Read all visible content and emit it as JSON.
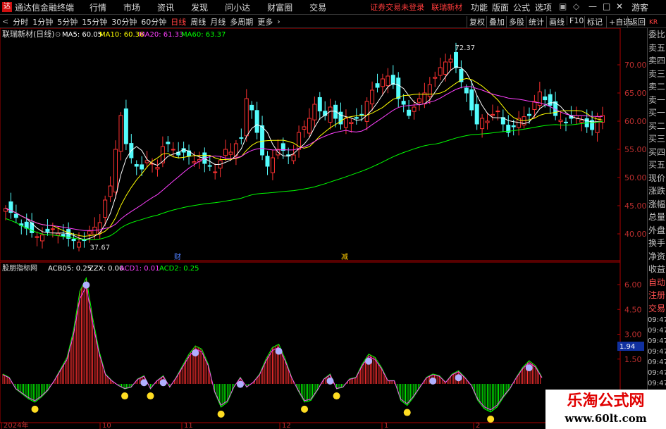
{
  "app": {
    "name": "通达信金融终端",
    "menus": [
      "行情",
      "市场",
      "资讯",
      "发现",
      "问小达",
      "财富圈",
      "交易"
    ],
    "notice": "证券交易未登录",
    "stock_title": "联瑞新材",
    "right_menus": [
      "功能",
      "版面",
      "公式",
      "选项"
    ],
    "guest": "游客"
  },
  "toolbar": {
    "periods": [
      "分时",
      "1分钟",
      "5分钟",
      "15分钟",
      "30分钟",
      "60分钟",
      "日线",
      "周线",
      "月线",
      "多周期",
      "更多"
    ],
    "active": "日线",
    "right_buttons": [
      "复权",
      "叠加",
      "多股",
      "统计",
      "画线",
      "F10",
      "标记",
      "+自选",
      "返回"
    ]
  },
  "main": {
    "name": "联瑞新材(日线)",
    "ma": [
      {
        "label": "MA5: 60.05",
        "color": "#ffffff"
      },
      {
        "label": "MA10: 60.36",
        "color": "#ffff00"
      },
      {
        "label": "MA20: 61.33",
        "color": "#ff40ff"
      },
      {
        "label": "MA60: 63.37",
        "color": "#00ff00"
      }
    ],
    "y_ticks": [
      "70.00",
      "65.00",
      "60.00",
      "55.00",
      "50.00",
      "45.00",
      "40.00"
    ],
    "hi_label": "72.37",
    "lo_label": "37.67",
    "mark1": "财",
    "mark2": "减"
  },
  "indicator": {
    "name": "股朋指标网",
    "fields": [
      {
        "label": "ACB05: 0.25",
        "color": "#ffffff"
      },
      {
        "label": "ZZX: 0.00",
        "color": "#ffffff"
      },
      {
        "label": "ACD1: 0.01",
        "color": "#ff40ff"
      },
      {
        "label": "ACD2: 0.25",
        "color": "#00ff00"
      }
    ],
    "y_ticks": [
      "6.00",
      "4.50",
      "3.00",
      "1.50"
    ],
    "current": "1.94"
  },
  "x_labels": [
    "2024年",
    "10",
    "11",
    "12",
    "1",
    "2"
  ],
  "side": {
    "top": [
      "委比",
      "卖五",
      "卖四",
      "卖三",
      "卖二",
      "卖一",
      "买一",
      "买二",
      "买三",
      "买四",
      "买五",
      "现价",
      "涨跌",
      "涨幅",
      "总量",
      "外盘",
      "换手",
      "净资",
      "收益"
    ],
    "bottom": [
      "自动",
      "注册",
      "交易"
    ],
    "times": [
      "09:47",
      "09:47",
      "09:47",
      "09:47",
      "09:47",
      "09:47",
      "09:47",
      "09:47"
    ],
    "corner": "KR"
  },
  "watermark": {
    "line1": "乐淘公式网",
    "line2": "www.60lt.com"
  },
  "chart_data": {
    "type": "candlestick",
    "closes": [
      44.5,
      43.8,
      42.9,
      41.5,
      41.0,
      40.2,
      39.5,
      39.8,
      40.4,
      40.9,
      40.1,
      39.6,
      39.2,
      38.8,
      38.5,
      38.9,
      40.5,
      41.2,
      42.0,
      46.0,
      48.5,
      55.0,
      61.0,
      56.0,
      53.5,
      52.0,
      51.5,
      53.0,
      52.5,
      51.8,
      55.5,
      56.0,
      55.0,
      54.0,
      54.5,
      53.8,
      52.8,
      53.2,
      52.5,
      52.0,
      51.0,
      53.0,
      55.0,
      54.5,
      56.0,
      57.0,
      64.0,
      62.0,
      58.0,
      54.0,
      52.0,
      53.5,
      55.0,
      54.8,
      53.8,
      54.0,
      58.0,
      59.0,
      60.5,
      63.0,
      61.8,
      61.0,
      62.5,
      60.5,
      59.5,
      60.5,
      59.8,
      60.5,
      61.0,
      63.5,
      65.5,
      66.0,
      67.5,
      68.0,
      66.5,
      64.0,
      63.0,
      61.0,
      62.5,
      64.0,
      65.0,
      66.5,
      67.8,
      69.5,
      70.5,
      71.0,
      69.5,
      67.0,
      65.0,
      62.0,
      59.5,
      60.5,
      60.0,
      61.2,
      61.8,
      59.5,
      58.0,
      59.0,
      60.5,
      60.8,
      61.0,
      63.5,
      65.2,
      63.8,
      62.8,
      61.0,
      60.2,
      59.8,
      60.5,
      61.0,
      60.2,
      59.0,
      58.5,
      60.8,
      61.0
    ],
    "hi_low": [
      72.37,
      37.67
    ],
    "ind": [
      0.6,
      0.4,
      -0.3,
      -0.6,
      -0.9,
      -1.1,
      -0.8,
      -0.4,
      0.2,
      0.9,
      1.6,
      3.2,
      5.6,
      6.4,
      4.0,
      2.0,
      0.6,
      0.2,
      -0.1,
      -0.3,
      -0.2,
      0.3,
      0.5,
      -0.3,
      0.2,
      0.5,
      -0.2,
      0.4,
      1.1,
      1.8,
      2.3,
      2.1,
      1.2,
      -0.5,
      -1.4,
      -1.1,
      -0.2,
      0.4,
      -0.2,
      0.1,
      0.6,
      1.5,
      2.2,
      2.4,
      1.5,
      0.4,
      -0.4,
      -1.1,
      -1.0,
      -0.4,
      0.3,
      0.6,
      -0.3,
      -0.2,
      0.3,
      0.4,
      1.2,
      1.8,
      1.6,
      1.0,
      0.2,
      0.2,
      -1.0,
      -1.3,
      -0.8,
      -0.2,
      0.4,
      0.6,
      0.5,
      0.1,
      0.6,
      0.8,
      0.4,
      -0.1,
      -1.0,
      -1.5,
      -1.7,
      -1.4,
      -0.8,
      -0.3,
      0.4,
      1.0,
      1.4,
      1.1,
      0.4
    ]
  }
}
